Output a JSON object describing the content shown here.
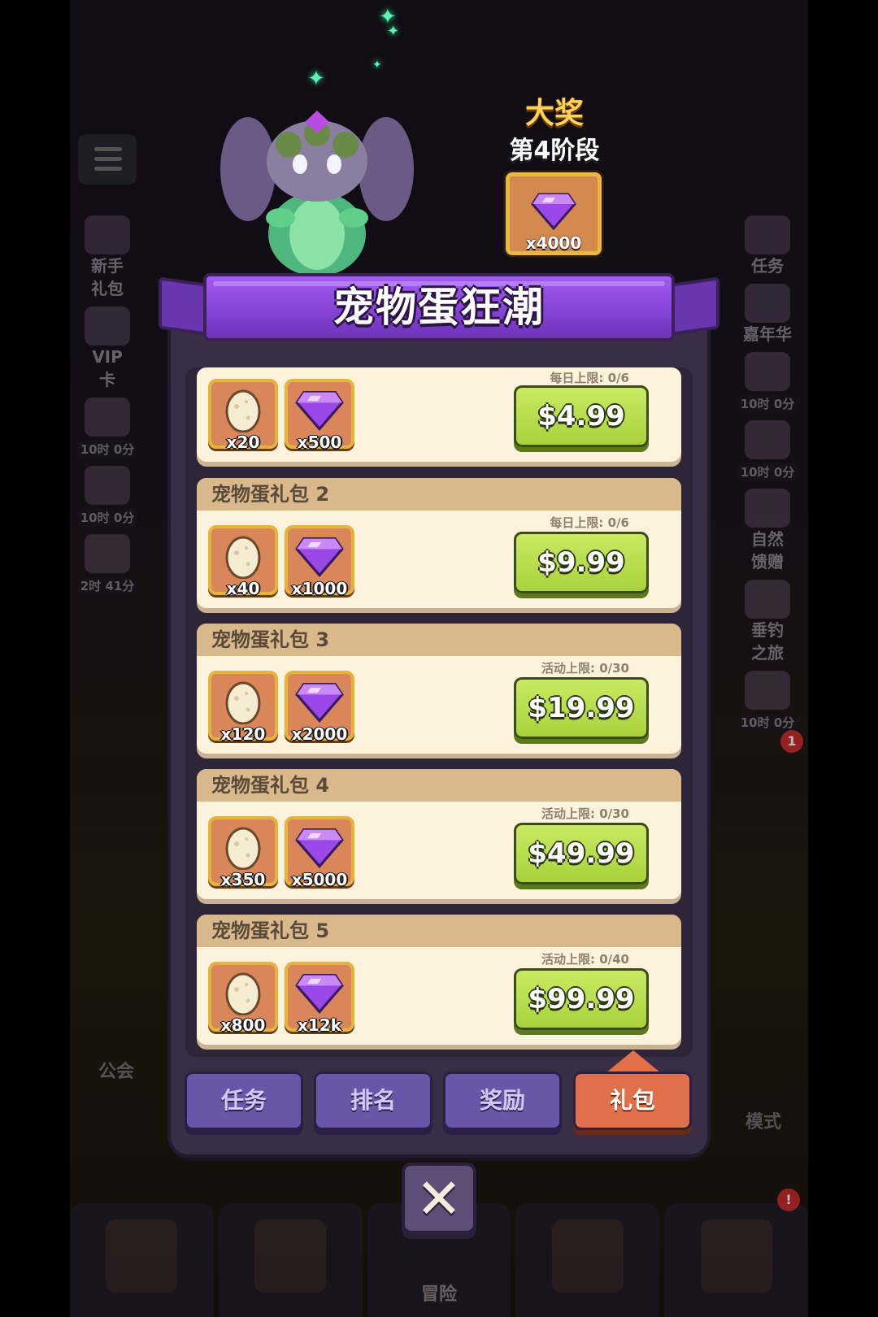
{
  "event": {
    "title": "宠物蛋狂潮",
    "grand_prize": {
      "label": "大奖",
      "stage": "第4阶段",
      "reward_qty": "x4000",
      "reward_icon": "gem-icon"
    }
  },
  "background": {
    "left_menu": [
      {
        "label": "新手\n礼包",
        "timer": ""
      },
      {
        "label": "VIP\n卡",
        "timer": ""
      },
      {
        "label": "",
        "timer": "10时 0分"
      },
      {
        "label": "",
        "timer": "10时 0分"
      },
      {
        "label": "",
        "timer": "2时 41分"
      }
    ],
    "right_menu": [
      {
        "label": "任务",
        "timer": ""
      },
      {
        "label": "嘉年华",
        "timer": ""
      },
      {
        "label": "",
        "timer": "10时 0分"
      },
      {
        "label": "",
        "timer": "10时 0分"
      },
      {
        "label": "自然\n馈赠",
        "timer": ""
      },
      {
        "label": "垂钓\n之旅",
        "timer": ""
      },
      {
        "label": "",
        "timer": "10时 0分"
      }
    ],
    "guild_label": "公会",
    "mode_label": "模式",
    "right_badge": "1",
    "nav_badge": "!",
    "bottom_nav": [
      "",
      "",
      "冒险",
      "",
      ""
    ]
  },
  "packages": [
    {
      "name": "",
      "limit": "每日上限: 0/6",
      "eggs": "x20",
      "gems": "x500",
      "price": "$4.99"
    },
    {
      "name": "宠物蛋礼包 2",
      "limit": "每日上限: 0/6",
      "eggs": "x40",
      "gems": "x1000",
      "price": "$9.99"
    },
    {
      "name": "宠物蛋礼包 3",
      "limit": "活动上限: 0/30",
      "eggs": "x120",
      "gems": "x2000",
      "price": "$19.99"
    },
    {
      "name": "宠物蛋礼包 4",
      "limit": "活动上限: 0/30",
      "eggs": "x350",
      "gems": "x5000",
      "price": "$49.99"
    },
    {
      "name": "宠物蛋礼包 5",
      "limit": "活动上限: 0/40",
      "eggs": "x800",
      "gems": "x12k",
      "price": "$99.99"
    }
  ],
  "tabs": [
    {
      "label": "任务",
      "active": false
    },
    {
      "label": "排名",
      "active": false
    },
    {
      "label": "奖励",
      "active": false
    },
    {
      "label": "礼包",
      "active": true
    }
  ],
  "icons": {
    "egg": "egg-icon",
    "gem": "gem-icon",
    "close": "close-icon"
  },
  "colors": {
    "accent_purple": "#8342d4",
    "buy_green": "#a8d23c",
    "tab_active": "#e0704a",
    "tab_inactive": "#6a55a8"
  }
}
